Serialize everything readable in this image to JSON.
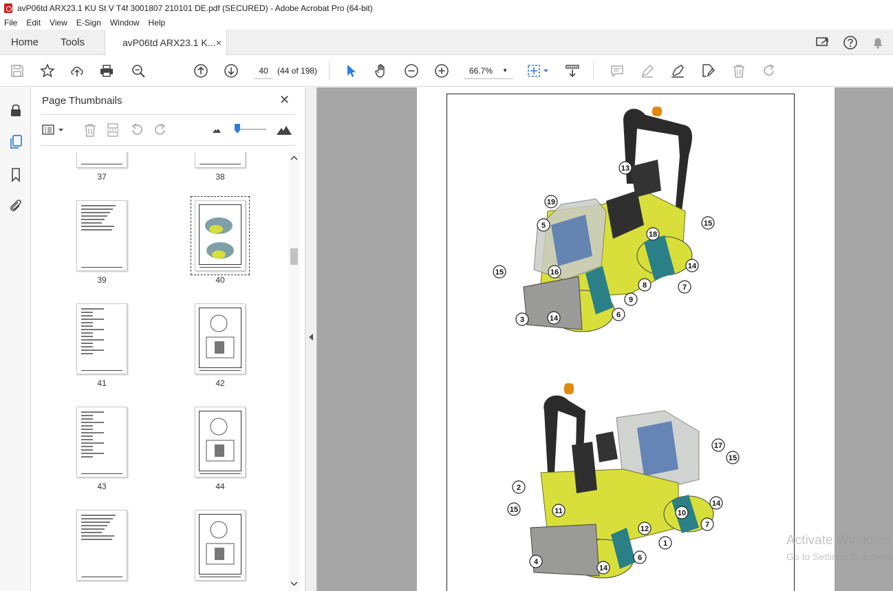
{
  "window": {
    "title": "avP06td ARX23.1 KU St V T4f 3001807 210101 DE.pdf (SECURED) - Adobe Acrobat Pro (64-bit)"
  },
  "menu": [
    "File",
    "Edit",
    "View",
    "E-Sign",
    "Window",
    "Help"
  ],
  "tabs": {
    "home": "Home",
    "tools": "Tools",
    "document": "avP06td ARX23.1 K...",
    "close": "×"
  },
  "toolbar": {
    "page_input": "40",
    "page_count": "(44 of 198)",
    "zoom": "66.7%",
    "zoom_arrow": "▼"
  },
  "panel": {
    "title": "Page Thumbnails",
    "close": "✕",
    "thumbnails": [
      {
        "label": "37",
        "kind": "blank"
      },
      {
        "label": "38",
        "kind": "blank"
      },
      {
        "label": "39",
        "kind": "text"
      },
      {
        "label": "40",
        "kind": "machine",
        "selected": true
      },
      {
        "label": "41",
        "kind": "list"
      },
      {
        "label": "42",
        "kind": "diagram"
      },
      {
        "label": "43",
        "kind": "list"
      },
      {
        "label": "44",
        "kind": "diagram"
      },
      {
        "label": "",
        "kind": "text2"
      },
      {
        "label": "",
        "kind": "diagram"
      }
    ]
  },
  "document": {
    "callouts_top": [
      "13",
      "19",
      "5",
      "18",
      "15",
      "14",
      "15",
      "16",
      "8",
      "7",
      "9",
      "14",
      "6",
      "3"
    ],
    "callouts_bottom": [
      "17",
      "15",
      "2",
      "11",
      "14",
      "15",
      "10",
      "12",
      "7",
      "1",
      "6",
      "4",
      "14"
    ]
  },
  "watermark": {
    "line1": "Activate Windows",
    "line2": "Go to Settings to activate Windows."
  },
  "colors": {
    "accent": "#2d7ce6",
    "machine_yellow": "#d8df3a",
    "pdf_red": "#c9221f"
  }
}
